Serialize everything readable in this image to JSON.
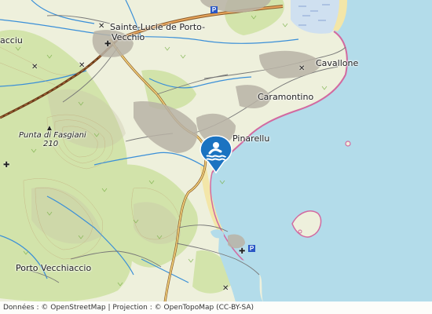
{
  "map": {
    "places": [
      {
        "name": "Sainte-Lucie de Porto-",
        "key": "sainte_lucie_1"
      },
      {
        "name": "Vecchio",
        "key": "sainte_lucie_2"
      },
      {
        "name": "Cavallone",
        "key": "cavallone"
      },
      {
        "name": "Caramontino",
        "key": "caramontino"
      },
      {
        "name": "Pinarellu",
        "key": "pinarellu"
      },
      {
        "name": "Porto Vecchiaccio",
        "key": "porto_vecchiaccio"
      },
      {
        "name": "acciu",
        "key": "acciu"
      }
    ],
    "summit": {
      "name": "Punta di Fasgiani",
      "elevation": "210"
    },
    "marker": {
      "type": "beach-swimming",
      "color": "#1b73c1"
    },
    "colors": {
      "sea": "#b3dcea",
      "land": "#eef0dc",
      "forest": "#cfe2a5",
      "road": "#c9883c",
      "rail": "#6b3b1a",
      "water": "#3a8fd8"
    }
  },
  "attribution": {
    "prefix": "Données : © ",
    "osm": "OpenStreetMap",
    "sep": " | Projection : © ",
    "otm": "OpenTopoMap",
    "license": " (CC-BY-SA)"
  }
}
